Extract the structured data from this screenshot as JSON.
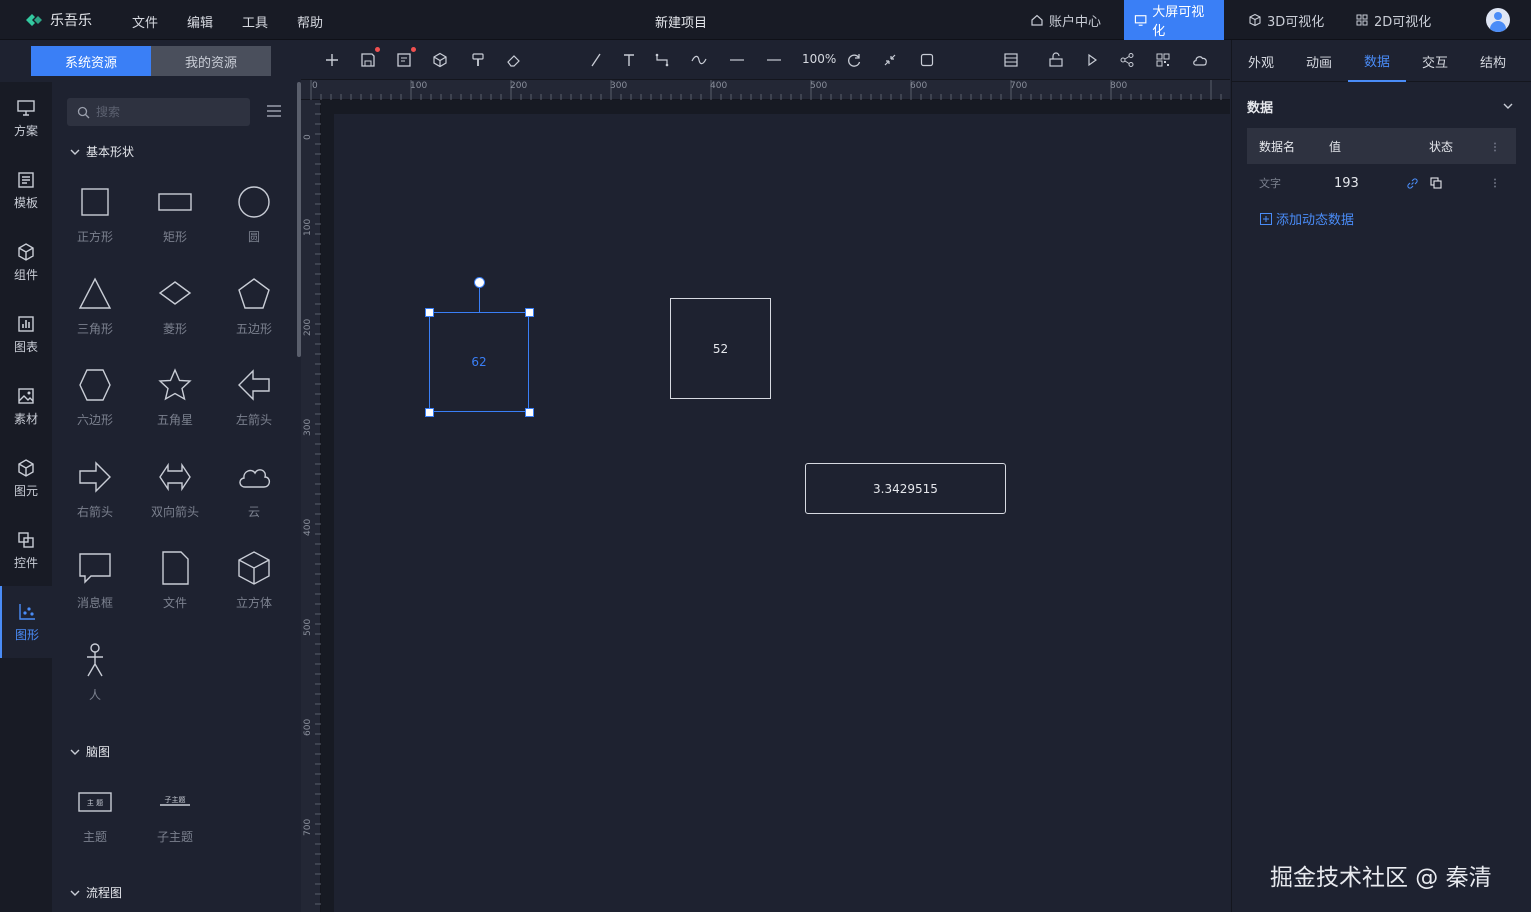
{
  "app": {
    "name": "乐吾乐",
    "doc_title": "新建项目"
  },
  "menu": [
    "文件",
    "编辑",
    "工具",
    "帮助"
  ],
  "top_nav": {
    "account": "账户中心",
    "big_screen": "大屏可视化",
    "viz3d": "3D可视化",
    "viz2d": "2D可视化"
  },
  "resource_tabs": {
    "system": "系统资源",
    "mine": "我的资源"
  },
  "rail": [
    "方案",
    "模板",
    "组件",
    "图表",
    "素材",
    "图元",
    "控件",
    "图形"
  ],
  "search": {
    "placeholder": "搜索"
  },
  "sections": {
    "basic": "基本形状",
    "mind": "脑图",
    "flow": "流程图"
  },
  "shapes": [
    "正方形",
    "矩形",
    "圆",
    "三角形",
    "菱形",
    "五边形",
    "六边形",
    "五角星",
    "左箭头",
    "右箭头",
    "双向箭头",
    "云",
    "消息框",
    "文件",
    "立方体",
    "人"
  ],
  "mind_shapes": {
    "topic": "主题",
    "subtopic": "子主题",
    "topic_glyph": "主 题",
    "subtopic_glyph": "子主题"
  },
  "toolbar": {
    "zoom": "100%"
  },
  "ruler": {
    "h": [
      "0",
      "100",
      "200",
      "300",
      "400",
      "500",
      "600",
      "700",
      "800"
    ],
    "v": [
      "0",
      "100",
      "200",
      "300",
      "400",
      "500",
      "600",
      "700"
    ]
  },
  "canvas": {
    "node_selected": "62",
    "node_square": "52",
    "node_rect": "3.3429515"
  },
  "right_tabs": [
    "外观",
    "动画",
    "数据",
    "交互",
    "结构"
  ],
  "data_panel": {
    "title": "数据",
    "headers": {
      "name": "数据名",
      "value": "值",
      "state": "状态"
    },
    "rows": [
      {
        "name": "文字",
        "value": "193"
      }
    ],
    "add": "添加动态数据"
  },
  "watermark": "掘金技术社区 @ 秦清",
  "colors": {
    "accent": "#3a7ff6",
    "bg": "#1e2230",
    "bar": "#181b25"
  }
}
